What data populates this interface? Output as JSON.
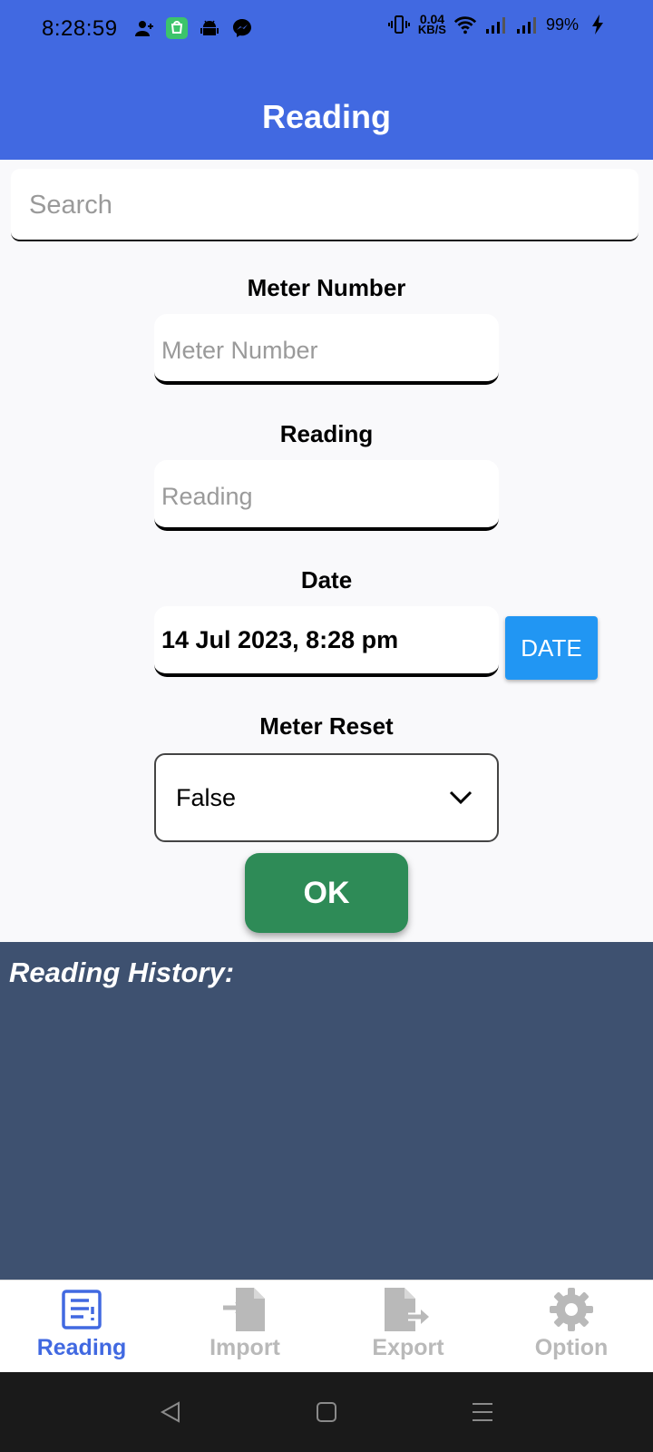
{
  "status_bar": {
    "time": "8:28:59",
    "net_speed": "0.04",
    "net_unit": "KB/S",
    "battery": "99%",
    "left_icons": [
      "person-add-icon",
      "shop-icon",
      "android-icon",
      "messenger-icon"
    ],
    "right_icons": [
      "vibrate-icon",
      "wifi-icon",
      "signal-icon",
      "signal-icon",
      "charging-icon"
    ]
  },
  "header": {
    "title": "Reading"
  },
  "search": {
    "placeholder": "Search",
    "value": ""
  },
  "form": {
    "meter_number": {
      "label": "Meter Number",
      "placeholder": "Meter Number",
      "value": ""
    },
    "reading": {
      "label": "Reading",
      "placeholder": "Reading",
      "value": ""
    },
    "date": {
      "label": "Date",
      "value": "14 Jul 2023, 8:28 pm",
      "button_label": "DATE"
    },
    "meter_reset": {
      "label": "Meter Reset",
      "selected": "False"
    },
    "ok_label": "OK"
  },
  "history": {
    "title": "Reading History:"
  },
  "bottom_nav": [
    {
      "label": "Reading",
      "icon": "reading-list-icon",
      "active": true
    },
    {
      "label": "Import",
      "icon": "import-file-icon",
      "active": false
    },
    {
      "label": "Export",
      "icon": "export-file-icon",
      "active": false
    },
    {
      "label": "Option",
      "icon": "gear-icon",
      "active": false
    }
  ],
  "colors": {
    "header": "#4169e1",
    "ok_button": "#2e8b57",
    "date_button": "#2196f3",
    "history_bg": "#3e5170",
    "nav_active": "#4169e1",
    "nav_inactive": "#b9b9b9"
  }
}
